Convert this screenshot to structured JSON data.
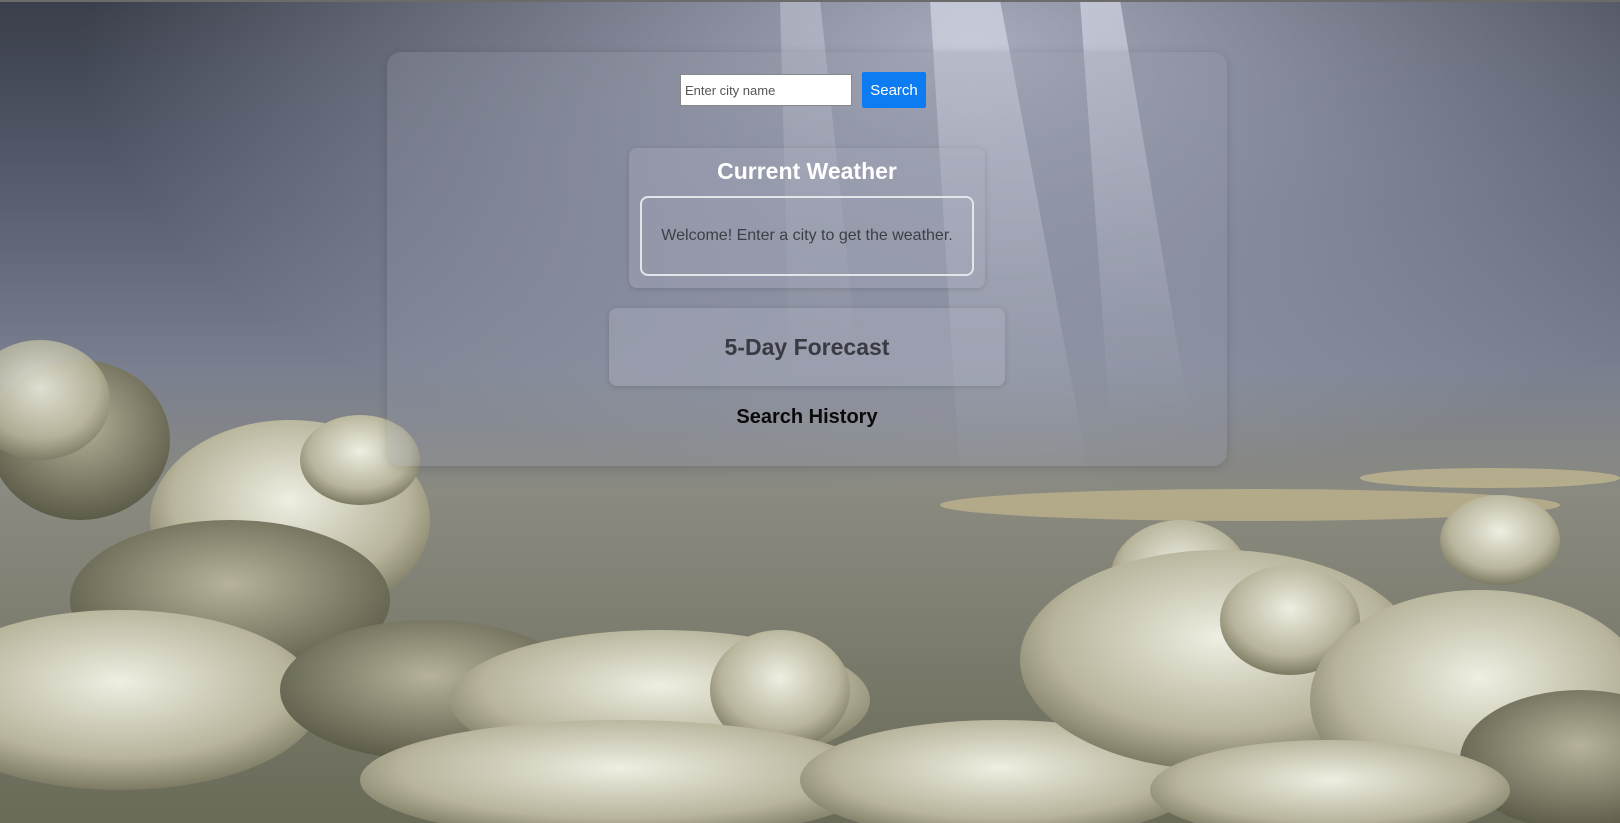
{
  "search": {
    "placeholder": "Enter city name",
    "value": "",
    "button_label": "Search"
  },
  "current_weather": {
    "title": "Current Weather",
    "message": "Welcome! Enter a city to get the weather."
  },
  "forecast": {
    "title": "5-Day Forecast"
  },
  "history": {
    "title": "Search History"
  },
  "colors": {
    "accent": "#0d7cf2"
  }
}
